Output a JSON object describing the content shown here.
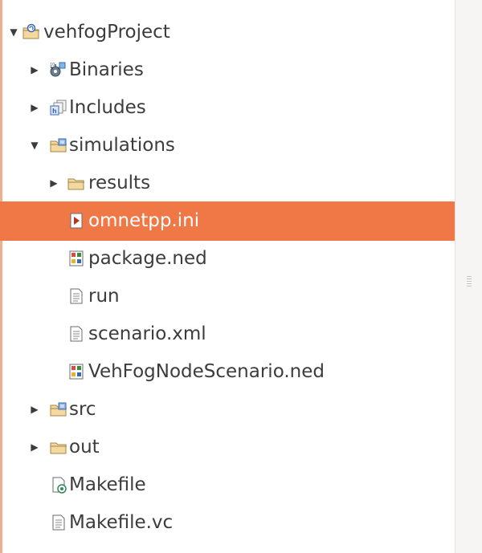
{
  "tree": {
    "items": [
      {
        "label": "vehfogProject",
        "icon": "project-folder-icon",
        "expanded": true
      },
      {
        "label": "Binaries",
        "icon": "binaries-icon",
        "expanded": false
      },
      {
        "label": "Includes",
        "icon": "includes-icon",
        "expanded": false
      },
      {
        "label": "simulations",
        "icon": "source-folder-icon",
        "expanded": true
      },
      {
        "label": "results",
        "icon": "folder-icon",
        "expanded": false
      },
      {
        "label": "omnetpp.ini",
        "icon": "ini-file-icon",
        "selected": true
      },
      {
        "label": "package.ned",
        "icon": "ned-file-icon"
      },
      {
        "label": "run",
        "icon": "text-file-icon"
      },
      {
        "label": "scenario.xml",
        "icon": "text-file-icon"
      },
      {
        "label": "VehFogNodeScenario.ned",
        "icon": "ned-file-icon"
      },
      {
        "label": "src",
        "icon": "source-folder-icon",
        "expanded": false
      },
      {
        "label": "out",
        "icon": "folder-icon",
        "expanded": false
      },
      {
        "label": "Makefile",
        "icon": "makefile-icon"
      },
      {
        "label": "Makefile.vc",
        "icon": "text-file-icon"
      }
    ]
  },
  "colors": {
    "selection": "#f07746",
    "selection_text": "#ffffff",
    "text": "#3c3c3c"
  }
}
